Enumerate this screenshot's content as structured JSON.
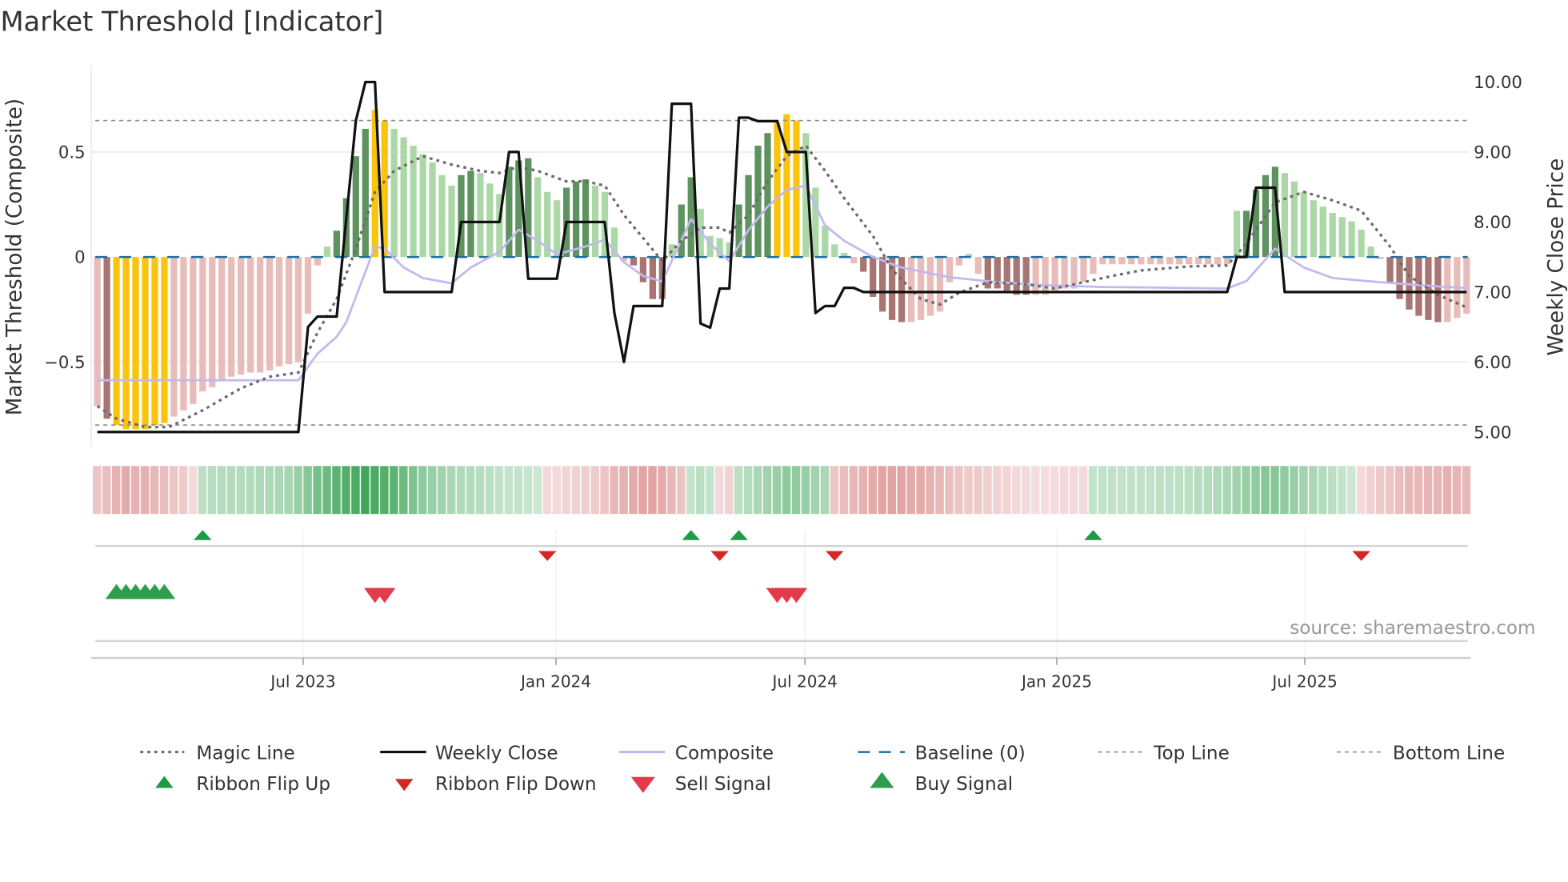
{
  "title": "Market Threshold [Indicator]",
  "source": "source: sharemaestro.com",
  "chart_data": {
    "type": "bar",
    "title": "Market Threshold [Indicator]",
    "ylabel_left": "Market Threshold (Composite)",
    "ylabel_right": "Weekly Close Price",
    "x_unit": "week index (weekly bars)",
    "grid": true,
    "legend_position": "bottom",
    "y_left": {
      "range": [
        -0.9,
        0.92
      ],
      "ticks": [
        {
          "value": 0.5,
          "label": "0.5"
        },
        {
          "value": 0,
          "label": "0"
        },
        {
          "value": -0.5,
          "label": "−0.5"
        }
      ]
    },
    "y_right": {
      "note": "price = 7.5 + 3 * composite",
      "range": [
        4.8,
        10.26
      ],
      "ticks": [
        {
          "value": 10,
          "label": "10.00"
        },
        {
          "value": 9,
          "label": "9.00"
        },
        {
          "value": 8,
          "label": "8.00"
        },
        {
          "value": 7,
          "label": "7.00"
        },
        {
          "value": 6,
          "label": "6.00"
        },
        {
          "value": 5,
          "label": "5.00"
        }
      ]
    },
    "x_ticks": [
      {
        "week_index": 21.5,
        "label": "Jul 2023"
      },
      {
        "week_index": 47.9,
        "label": "Jan 2024"
      },
      {
        "week_index": 73.9,
        "label": "Jul 2024"
      },
      {
        "week_index": 100.2,
        "label": "Jan 2025"
      },
      {
        "week_index": 126.1,
        "label": "Jul 2025"
      }
    ],
    "reference_lines": {
      "top": 0.65,
      "bottom": -0.8,
      "baseline": 0
    },
    "colors": {
      "Y": "#fbc40c",
      "DG": "#5e925f",
      "LG": "#acd8a7",
      "DR": "#a87572",
      "LR": "#e8bcb8",
      "weekly_close": "#111111",
      "composite": "#c2b8f0",
      "magic": "#6b6b6b",
      "baseline": "#1f6f9f",
      "ref": "#8a8a8a",
      "flip_up": "#1f9a47",
      "flip_down": "#d62728",
      "buy": "#2e9e4c",
      "sell": "#e23c4a"
    },
    "composite_bars": {
      "values": [
        -0.71,
        -0.77,
        -0.8,
        -0.82,
        -0.82,
        -0.82,
        -0.8,
        -0.79,
        -0.76,
        -0.73,
        -0.7,
        -0.64,
        -0.62,
        -0.59,
        -0.57,
        -0.56,
        -0.55,
        -0.55,
        -0.54,
        -0.52,
        -0.51,
        -0.5,
        -0.27,
        -0.04,
        0.05,
        0.125,
        0.28,
        0.48,
        0.61,
        0.7,
        0.65,
        0.61,
        0.57,
        0.53,
        0.49,
        0.45,
        0.39,
        0.34,
        0.39,
        0.41,
        0.4,
        0.35,
        0.3,
        0.43,
        0.46,
        0.47,
        0.38,
        0.31,
        0.27,
        0.33,
        0.36,
        0.37,
        0.34,
        0.31,
        0.14,
        -0.02,
        -0.04,
        -0.12,
        -0.2,
        -0.2,
        0.06,
        0.25,
        0.38,
        0.23,
        0.1,
        0.09,
        0.07,
        0.25,
        0.39,
        0.53,
        0.59,
        0.64,
        0.68,
        0.65,
        0.59,
        0.33,
        0.15,
        0.06,
        0.02,
        -0.03,
        -0.07,
        -0.19,
        -0.26,
        -0.3,
        -0.31,
        -0.31,
        -0.3,
        -0.28,
        -0.26,
        -0.12,
        -0.04,
        0.015,
        -0.08,
        -0.15,
        -0.15,
        -0.16,
        -0.18,
        -0.18,
        -0.18,
        -0.18,
        -0.16,
        -0.15,
        -0.15,
        -0.12,
        -0.08,
        -0.035,
        -0.035,
        -0.035,
        -0.035,
        -0.035,
        -0.035,
        -0.035,
        -0.035,
        -0.035,
        -0.035,
        -0.035,
        -0.035,
        -0.035,
        -0.035,
        0.22,
        0.22,
        0.32,
        0.39,
        0.43,
        0.4,
        0.36,
        0.31,
        0.27,
        0.24,
        0.21,
        0.19,
        0.17,
        0.13,
        0.05,
        -0.01,
        -0.12,
        -0.2,
        -0.25,
        -0.28,
        -0.3,
        -0.31,
        -0.31,
        -0.29,
        -0.27
      ],
      "colors": [
        "LR",
        "DR",
        "Y",
        "Y",
        "Y",
        "Y",
        "Y",
        "Y",
        "LR",
        "LR",
        "LR",
        "LR",
        "LR",
        "LR",
        "LR",
        "LR",
        "LR",
        "LR",
        "LR",
        "LR",
        "LR",
        "LR",
        "LR",
        "LR",
        "LG",
        "DG",
        "DG",
        "DG",
        "DG",
        "Y",
        "Y",
        "LG",
        "LG",
        "LG",
        "LG",
        "LG",
        "LG",
        "LG",
        "DG",
        "DG",
        "LG",
        "LG",
        "LG",
        "DG",
        "DG",
        "DG",
        "LG",
        "LG",
        "LG",
        "DG",
        "DG",
        "DG",
        "LG",
        "LG",
        "LG",
        "LR",
        "DR",
        "DR",
        "DR",
        "DR",
        "LG",
        "DG",
        "DG",
        "LG",
        "LG",
        "LG",
        "LG",
        "DG",
        "DG",
        "DG",
        "DG",
        "Y",
        "Y",
        "Y",
        "LG",
        "LG",
        "LG",
        "LG",
        "LG",
        "LR",
        "DR",
        "DR",
        "DR",
        "DR",
        "DR",
        "LR",
        "LR",
        "LR",
        "LR",
        "LR",
        "LR",
        "LG",
        "LR",
        "DR",
        "DR",
        "DR",
        "DR",
        "DR",
        "LR",
        "LR",
        "LR",
        "LR",
        "LR",
        "LR",
        "LR",
        "LR",
        "LR",
        "LR",
        "LR",
        "LR",
        "LR",
        "LR",
        "LR",
        "LR",
        "LR",
        "LR",
        "LR",
        "LR",
        "LR",
        "LG",
        "DG",
        "DG",
        "DG",
        "DG",
        "LG",
        "LG",
        "LG",
        "LG",
        "LG",
        "LG",
        "LG",
        "LG",
        "LG",
        "LG",
        "LR",
        "DR",
        "DR",
        "DR",
        "DR",
        "DR",
        "DR",
        "LR",
        "LR",
        "LR"
      ]
    },
    "series": [
      {
        "name": "Weekly Close",
        "axis": "right",
        "points": [
          [
            0,
            5.0
          ],
          [
            21,
            5.0
          ],
          [
            22,
            6.5
          ],
          [
            23,
            6.65
          ],
          [
            25,
            6.65
          ],
          [
            27,
            9.45
          ],
          [
            28,
            10.0
          ],
          [
            29,
            10.0
          ],
          [
            30,
            7.0
          ],
          [
            37,
            7.0
          ],
          [
            38,
            8.0
          ],
          [
            42,
            8.0
          ],
          [
            43,
            9.0
          ],
          [
            44,
            9.0
          ],
          [
            45,
            7.19
          ],
          [
            48,
            7.19
          ],
          [
            49,
            8.0
          ],
          [
            53,
            8.0
          ],
          [
            54,
            6.7
          ],
          [
            55,
            6.0
          ],
          [
            56,
            6.8
          ],
          [
            59,
            6.8
          ],
          [
            60,
            9.69
          ],
          [
            62,
            9.69
          ],
          [
            63,
            6.55
          ],
          [
            64,
            6.49
          ],
          [
            65,
            7.05
          ],
          [
            66,
            7.05
          ],
          [
            67,
            9.49
          ],
          [
            68,
            9.49
          ],
          [
            69,
            9.44
          ],
          [
            71,
            9.44
          ],
          [
            72,
            9.0
          ],
          [
            74,
            9.0
          ],
          [
            75,
            6.7
          ],
          [
            76,
            6.8
          ],
          [
            77,
            6.8
          ],
          [
            78,
            7.06
          ],
          [
            79,
            7.06
          ],
          [
            80,
            7.0
          ],
          [
            118,
            7.0
          ],
          [
            119,
            7.5
          ],
          [
            120,
            7.5
          ],
          [
            121,
            8.49
          ],
          [
            123,
            8.49
          ],
          [
            124,
            7.0
          ],
          [
            143,
            7.0
          ]
        ]
      },
      {
        "name": "Composite",
        "axis": "left",
        "points": [
          [
            0,
            -0.587
          ],
          [
            21,
            -0.587
          ],
          [
            23,
            -0.46
          ],
          [
            25,
            -0.38
          ],
          [
            26,
            -0.31
          ],
          [
            29,
            0.05
          ],
          [
            30,
            0.04
          ],
          [
            32,
            -0.05
          ],
          [
            34,
            -0.1
          ],
          [
            37,
            -0.125
          ],
          [
            39,
            -0.05
          ],
          [
            42,
            0.025
          ],
          [
            44,
            0.13
          ],
          [
            46,
            0.077
          ],
          [
            48,
            0.013
          ],
          [
            51,
            0.05
          ],
          [
            53,
            0.083
          ],
          [
            55,
            -0.025
          ],
          [
            57,
            -0.09
          ],
          [
            59,
            -0.117
          ],
          [
            62,
            0.18
          ],
          [
            64,
            0.064
          ],
          [
            66,
            -0.02
          ],
          [
            68,
            0.128
          ],
          [
            70,
            0.24
          ],
          [
            72,
            0.32
          ],
          [
            74,
            0.34
          ],
          [
            76,
            0.15
          ],
          [
            78,
            0.077
          ],
          [
            81,
            0.0
          ],
          [
            84,
            -0.05
          ],
          [
            89,
            -0.096
          ],
          [
            94,
            -0.12
          ],
          [
            99,
            -0.134
          ],
          [
            105,
            -0.143
          ],
          [
            118,
            -0.15
          ],
          [
            120,
            -0.115
          ],
          [
            123,
            0.04
          ],
          [
            126,
            -0.05
          ],
          [
            129,
            -0.1
          ],
          [
            134,
            -0.12
          ],
          [
            140,
            -0.14
          ],
          [
            143,
            -0.147
          ]
        ]
      },
      {
        "name": "Magic Line",
        "axis": "left",
        "points": [
          [
            0,
            -0.71
          ],
          [
            2,
            -0.77
          ],
          [
            5,
            -0.81
          ],
          [
            7.5,
            -0.81
          ],
          [
            11,
            -0.73
          ],
          [
            15,
            -0.625
          ],
          [
            18,
            -0.57
          ],
          [
            21,
            -0.55
          ],
          [
            23,
            -0.36
          ],
          [
            25,
            -0.2
          ],
          [
            27,
            0.04
          ],
          [
            29,
            0.31
          ],
          [
            31,
            0.41
          ],
          [
            34,
            0.48
          ],
          [
            37,
            0.44
          ],
          [
            40,
            0.41
          ],
          [
            42,
            0.4
          ],
          [
            44,
            0.43
          ],
          [
            46,
            0.41
          ],
          [
            49,
            0.36
          ],
          [
            51,
            0.36
          ],
          [
            53,
            0.34
          ],
          [
            55,
            0.2
          ],
          [
            57,
            0.09
          ],
          [
            59,
            -0.02
          ],
          [
            61,
            0.077
          ],
          [
            63,
            0.14
          ],
          [
            65,
            0.14
          ],
          [
            66,
            0.115
          ],
          [
            68,
            0.2
          ],
          [
            70,
            0.36
          ],
          [
            72,
            0.48
          ],
          [
            74,
            0.53
          ],
          [
            76,
            0.41
          ],
          [
            78,
            0.28
          ],
          [
            81,
            0.1
          ],
          [
            83,
            -0.06
          ],
          [
            86,
            -0.2
          ],
          [
            88,
            -0.226
          ],
          [
            90,
            -0.17
          ],
          [
            93,
            -0.12
          ],
          [
            97,
            -0.13
          ],
          [
            100,
            -0.15
          ],
          [
            103,
            -0.12
          ],
          [
            106,
            -0.09
          ],
          [
            109,
            -0.064
          ],
          [
            114,
            -0.045
          ],
          [
            118,
            -0.04
          ],
          [
            120,
            0.064
          ],
          [
            123,
            0.26
          ],
          [
            126,
            0.31
          ],
          [
            129,
            0.27
          ],
          [
            132,
            0.22
          ],
          [
            135,
            0.05
          ],
          [
            137,
            -0.09
          ],
          [
            140,
            -0.18
          ],
          [
            143,
            -0.24
          ]
        ]
      }
    ],
    "ribbon": [
      -0.3,
      -0.35,
      -0.45,
      -0.5,
      -0.45,
      -0.45,
      -0.4,
      -0.35,
      -0.3,
      -0.25,
      -0.15,
      0.25,
      0.28,
      0.3,
      0.3,
      0.3,
      0.3,
      0.32,
      0.33,
      0.35,
      0.38,
      0.45,
      0.55,
      0.65,
      0.7,
      0.8,
      0.85,
      0.9,
      0.95,
      0.9,
      0.85,
      0.8,
      0.7,
      0.6,
      0.5,
      0.45,
      0.4,
      0.35,
      0.32,
      0.3,
      0.28,
      0.25,
      0.22,
      0.2,
      0.2,
      0.18,
      0.15,
      -0.15,
      -0.15,
      -0.18,
      -0.2,
      -0.22,
      -0.25,
      -0.3,
      -0.4,
      -0.45,
      -0.5,
      -0.55,
      -0.55,
      -0.5,
      -0.4,
      -0.3,
      0.2,
      0.25,
      0.2,
      -0.15,
      -0.2,
      0.25,
      0.3,
      0.35,
      0.4,
      0.45,
      0.5,
      0.5,
      0.45,
      0.4,
      0.35,
      -0.3,
      -0.35,
      -0.4,
      -0.45,
      -0.5,
      -0.55,
      -0.55,
      -0.55,
      -0.5,
      -0.5,
      -0.45,
      -0.4,
      -0.35,
      -0.3,
      -0.25,
      -0.25,
      -0.22,
      -0.2,
      -0.18,
      -0.15,
      -0.15,
      -0.12,
      -0.12,
      -0.12,
      -0.15,
      -0.15,
      -0.15,
      0.2,
      0.22,
      0.22,
      0.22,
      0.22,
      0.22,
      0.22,
      0.24,
      0.24,
      0.25,
      0.26,
      0.28,
      0.3,
      0.32,
      0.35,
      0.4,
      0.45,
      0.5,
      0.55,
      0.55,
      0.5,
      0.45,
      0.4,
      0.35,
      0.3,
      0.25,
      0.2,
      0.15,
      -0.15,
      -0.2,
      -0.25,
      -0.3,
      -0.35,
      -0.4,
      -0.4,
      -0.42,
      -0.42,
      -0.45,
      -0.42,
      -0.4
    ],
    "ribbon_flip_up": [
      11,
      62,
      67,
      104
    ],
    "ribbon_flip_down": [
      47,
      65,
      77,
      132
    ],
    "buy_signals": [
      2,
      3,
      4,
      5,
      6,
      7
    ],
    "sell_signals": [
      29,
      30,
      71,
      72,
      73
    ],
    "legend": [
      {
        "label": "Magic Line",
        "kind": "dotted"
      },
      {
        "label": "Weekly Close",
        "kind": "solid"
      },
      {
        "label": "Composite",
        "kind": "lavender"
      },
      {
        "label": "Baseline (0)",
        "kind": "dashed-blue"
      },
      {
        "label": "Top Line",
        "kind": "dashed-thin"
      },
      {
        "label": "Bottom Line",
        "kind": "dashed-thin"
      },
      {
        "label": "Ribbon Flip Up",
        "kind": "flip-up"
      },
      {
        "label": "Ribbon Flip Down",
        "kind": "flip-down"
      },
      {
        "label": "Sell Signal",
        "kind": "sell"
      },
      {
        "label": "Buy Signal",
        "kind": "buy"
      }
    ]
  }
}
